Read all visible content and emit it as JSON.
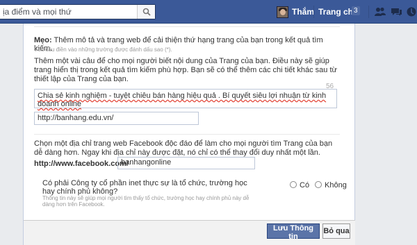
{
  "topbar": {
    "search_placeholder": "ịa điểm và mọi thứ",
    "user_name": "Thắm",
    "home_label": "Trang chủ",
    "home_count": "3",
    "brand_color": "#3b5998"
  },
  "form": {
    "tip_label": "Mẹo:",
    "tip_text": " Thêm mô tả và trang web để cải thiện thứ hạng trang của bạn trong kết quả tìm kiếm.",
    "required_note": "Yêu cầu điền vào những trường được đánh dấu sao (*).",
    "description_help": "Thêm một vài câu để cho mọi người biết nội dung của Trang của bạn. Điều này sẽ giúp trang hiển thị trong kết quả tìm kiếm phù hợp. Bạn sẽ có thể thêm các chi tiết khác sau từ thiết lập của Trang của bạn.",
    "char_count": "56",
    "description_value": "Chia sẻ kinh nghiệm - tuyệt chiêu bán hàng hiệu quả . Bí quyết siêu lợi nhuận từ kinh doanh online",
    "website_value": "http://banhang.edu.vn/",
    "address_help": "Chọn một địa chỉ trang web Facebook độc đáo để làm cho mọi người tìm Trang của bạn dễ dàng hơn. Ngay khi địa chỉ này được đặt, nó chỉ có thể thay đổi duy nhất một lần.",
    "fb_prefix": "http://www.facebook.com/",
    "fb_value": "banhangonline",
    "question": "Có phải Công ty cổ phần inet thực sự là tổ chức, trường học hay chính phủ không?",
    "question_help": "Thông tin này sẽ giúp mọi người tìm thấy tổ chức, trường học hay chính phủ này dễ dàng hơn trên Facebook.",
    "option_yes": "Có",
    "option_no": "Không"
  },
  "footer": {
    "save_label": "Lưu Thông tin",
    "skip_label": "Bỏ qua"
  }
}
